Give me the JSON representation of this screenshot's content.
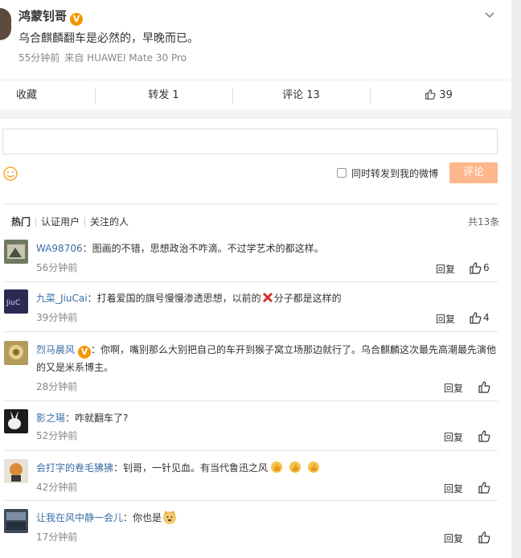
{
  "post": {
    "username": "鸿蒙钊哥",
    "verified_mark": "V",
    "text": "乌合麒麟翻车是必然的，早晚而已。",
    "time": "55分钟前",
    "source": "来自 HUAWEI Mate 30 Pro"
  },
  "actions": {
    "favorite": "收藏",
    "repost": "转发 1",
    "comment": "评论 13",
    "likes": "39"
  },
  "composer": {
    "input_value": "",
    "repost_option": "同时转发到我的微博",
    "submit": "评论"
  },
  "tabs": [
    "热门",
    "认证用户",
    "关注的人"
  ],
  "total": "共13条",
  "comments": [
    {
      "user": "WA98706",
      "sep": "：",
      "text": "图画的不错，思想政治不咋滴。不过学艺术的都这样。",
      "time": "56分钟前",
      "reply": "回复",
      "likes": "6"
    },
    {
      "user": "九菜_JiuCai",
      "sep": "：",
      "text_before": "打着爱国的旗号慢慢渗透思想，以前的",
      "text_after": "分子都是这样的",
      "time": "39分钟前",
      "reply": "回复",
      "likes": "4"
    },
    {
      "user": "烈马晨风",
      "verified_mark": "V",
      "sep": "：",
      "text": "你啊，嘴别那么大别把自己的车开到猴子窝立场那边就行了。乌合麒麟这次最先高潮最先演他的又是米系博主。",
      "time": "28分钟前",
      "reply": "回复",
      "likes": ""
    },
    {
      "user": "影之瑒",
      "sep": "：",
      "text": "咋就翻车了?",
      "time": "52分钟前",
      "reply": "回复",
      "likes": ""
    },
    {
      "user": "会打字的卷毛狒狒",
      "sep": "：",
      "text": "钊哥，一针见血。有当代鲁迅之风",
      "time": "42分钟前",
      "reply": "回复",
      "likes": ""
    },
    {
      "user": "让我在风中静一会儿",
      "sep": "：",
      "text": "你也是",
      "time": "17分钟前",
      "reply": "回复",
      "likes": ""
    }
  ],
  "colors": {
    "link": "#3b6ea5",
    "accent": "#fdb78b",
    "badge": "#f39800"
  }
}
